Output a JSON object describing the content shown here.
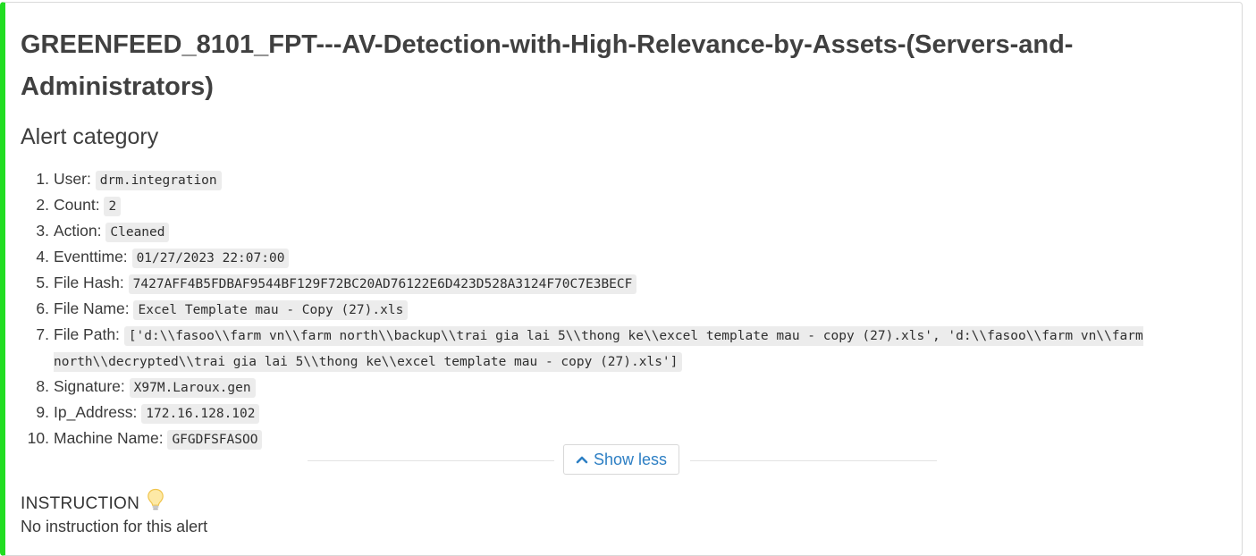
{
  "alert": {
    "title": "GREENFEED_8101_FPT---AV-Detection-with-High-Relevance-by-Assets-(Servers-and-Administrators)",
    "category_heading": "Alert category",
    "fields": [
      {
        "num": "1.",
        "label": "User:",
        "value": "drm.integration"
      },
      {
        "num": "2.",
        "label": "Count:",
        "value": "2"
      },
      {
        "num": "3.",
        "label": "Action:",
        "value": "Cleaned"
      },
      {
        "num": "4.",
        "label": "Eventtime:",
        "value": "01/27/2023 22:07:00"
      },
      {
        "num": "5.",
        "label": "File Hash:",
        "value": "7427AFF4B5FDBAF9544BF129F72BC20AD76122E6D423D528A3124F70C7E3BECF"
      },
      {
        "num": "6.",
        "label": "File Name:",
        "value": "Excel Template mau - Copy (27).xls"
      },
      {
        "num": "7.",
        "label": "File Path:",
        "value": "['d:\\\\fasoo\\\\farm vn\\\\farm north\\\\backup\\\\trai gia lai 5\\\\thong ke\\\\excel template mau - copy (27).xls', 'd:\\\\fasoo\\\\farm vn\\\\farm north\\\\decrypted\\\\trai gia lai 5\\\\thong ke\\\\excel template mau - copy (27).xls']"
      },
      {
        "num": "8.",
        "label": "Signature:",
        "value": "X97M.Laroux.gen"
      },
      {
        "num": "9.",
        "label": "Ip_Address:",
        "value": "172.16.128.102"
      },
      {
        "num": "10.",
        "label": "Machine Name:",
        "value": "GFGDFSFASOO"
      }
    ],
    "toggle_label": "Show less",
    "toggle_icon": "chevron-up-icon",
    "instruction_heading": "INSTRUCTION",
    "instruction_icon": "lightbulb-icon",
    "instruction_text": "No instruction for this alert"
  },
  "colors": {
    "status_bar": "#22dd22",
    "link": "#2d7fc4",
    "code_bg": "#ececec"
  }
}
